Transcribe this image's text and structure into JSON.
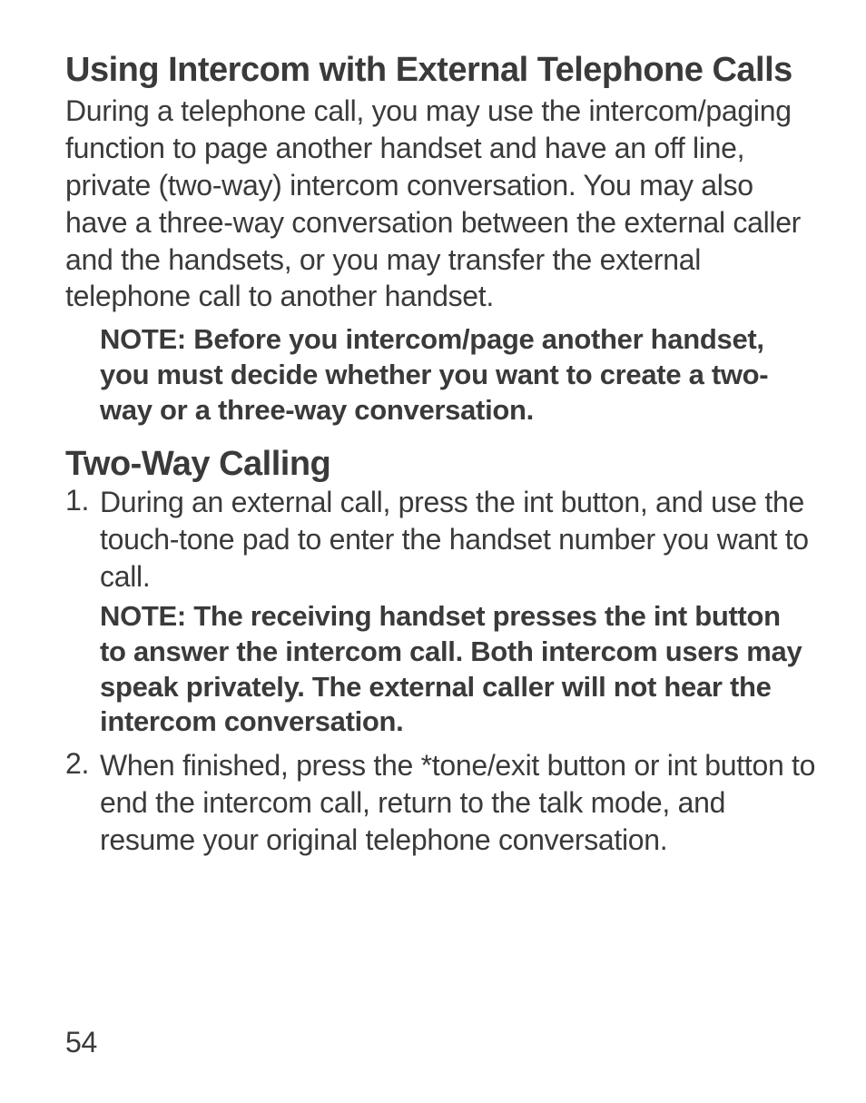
{
  "section1": {
    "heading": "Using Intercom with External Telephone Calls",
    "para": "During a telephone call, you may use the intercom/paging function to page another handset and have an off line, private (two-way) intercom conversation. You may also have a three-way conversation between the external caller and the handsets, or you may transfer the external telephone call to another handset.",
    "note": "NOTE: Before you intercom/page another handset, you must decide whether you want to create a two-way or a three-way conversation."
  },
  "section2": {
    "heading": "Two-Way Calling",
    "steps": [
      {
        "text": "During an external call, press the int button, and use the touch-tone pad to enter the handset number you want to call.",
        "note": "NOTE: The receiving handset presses the int button to answer the intercom call. Both intercom users may speak privately. The external caller will not hear the intercom conversation."
      },
      {
        "text": "When finished, press the *tone/exit button or int button to end the intercom call, return to the talk mode, and resume your original telephone conversation."
      }
    ]
  },
  "pageNumber": "54"
}
